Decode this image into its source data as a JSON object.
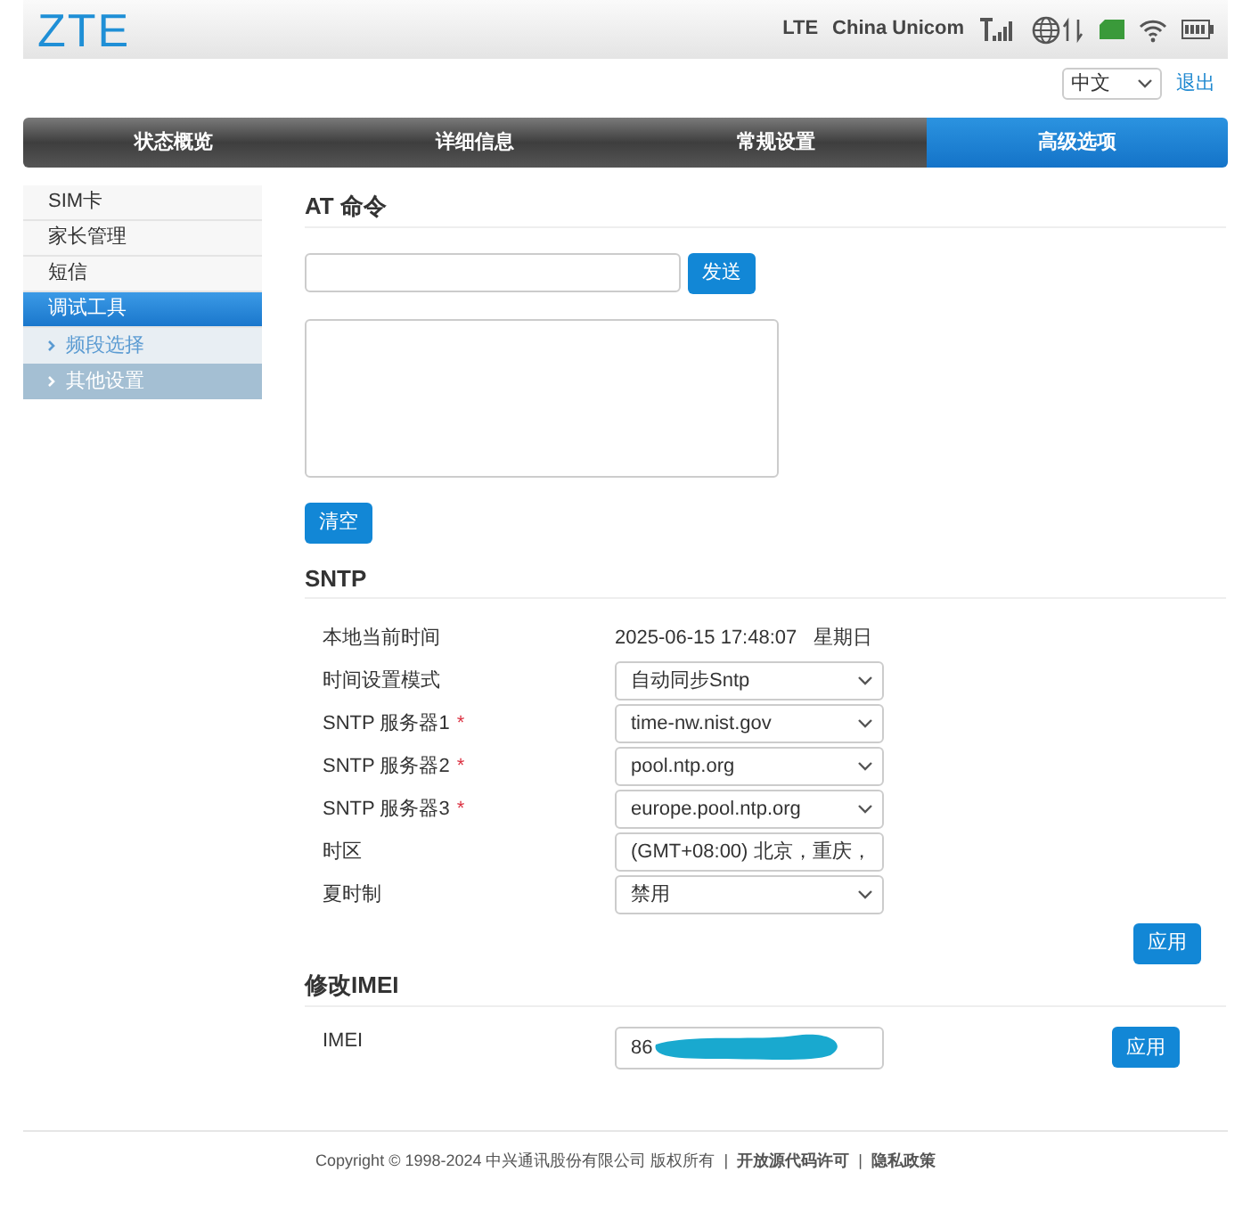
{
  "header": {
    "logo": "ZTE",
    "network": "LTE",
    "carrier": "China Unicom"
  },
  "language": {
    "value": "中文"
  },
  "logout": "退出",
  "tabs": [
    {
      "label": "状态概览",
      "selected": false
    },
    {
      "label": "详细信息",
      "selected": false
    },
    {
      "label": "常规设置",
      "selected": false
    },
    {
      "label": "高级选项",
      "selected": true
    }
  ],
  "sidebar": {
    "items": [
      {
        "label": "SIM卡",
        "selected": false
      },
      {
        "label": "家长管理",
        "selected": false
      },
      {
        "label": "短信",
        "selected": false
      },
      {
        "label": "调试工具",
        "selected": true,
        "children": [
          {
            "label": "频段选择",
            "selected": false
          },
          {
            "label": "其他设置",
            "selected": true
          }
        ]
      }
    ]
  },
  "at_command": {
    "title": "AT 命令",
    "send_button": "发送",
    "clear_button": "清空"
  },
  "sntp": {
    "title": "SNTP",
    "rows": [
      {
        "kind": "text",
        "label": "本地当前时间",
        "value": "2025-06-15 17:48:07   星期日"
      },
      {
        "kind": "select",
        "label": "时间设置模式",
        "value": "自动同步Sntp"
      },
      {
        "kind": "select",
        "label": "SNTP 服务器1",
        "required_mark": "*",
        "value": "time-nw.nist.gov"
      },
      {
        "kind": "select",
        "label": "SNTP 服务器2",
        "required_mark": "*",
        "value": "pool.ntp.org"
      },
      {
        "kind": "select",
        "label": "SNTP 服务器3",
        "required_mark": "*",
        "value": "europe.pool.ntp.org"
      },
      {
        "kind": "select",
        "label": "时区",
        "value": "(GMT+08:00) 北京，重庆，"
      },
      {
        "kind": "select",
        "label": "夏时制",
        "value": "禁用"
      }
    ],
    "apply_button": "应用"
  },
  "imei": {
    "title": "修改IMEI",
    "label": "IMEI",
    "value": "86",
    "apply_button": "应用"
  },
  "footer": {
    "copyright": "Copyright © 1998-2024 中兴通讯股份有限公司 版权所有",
    "separator": "|",
    "links": [
      "开放源代码许可",
      "隐私政策"
    ]
  }
}
